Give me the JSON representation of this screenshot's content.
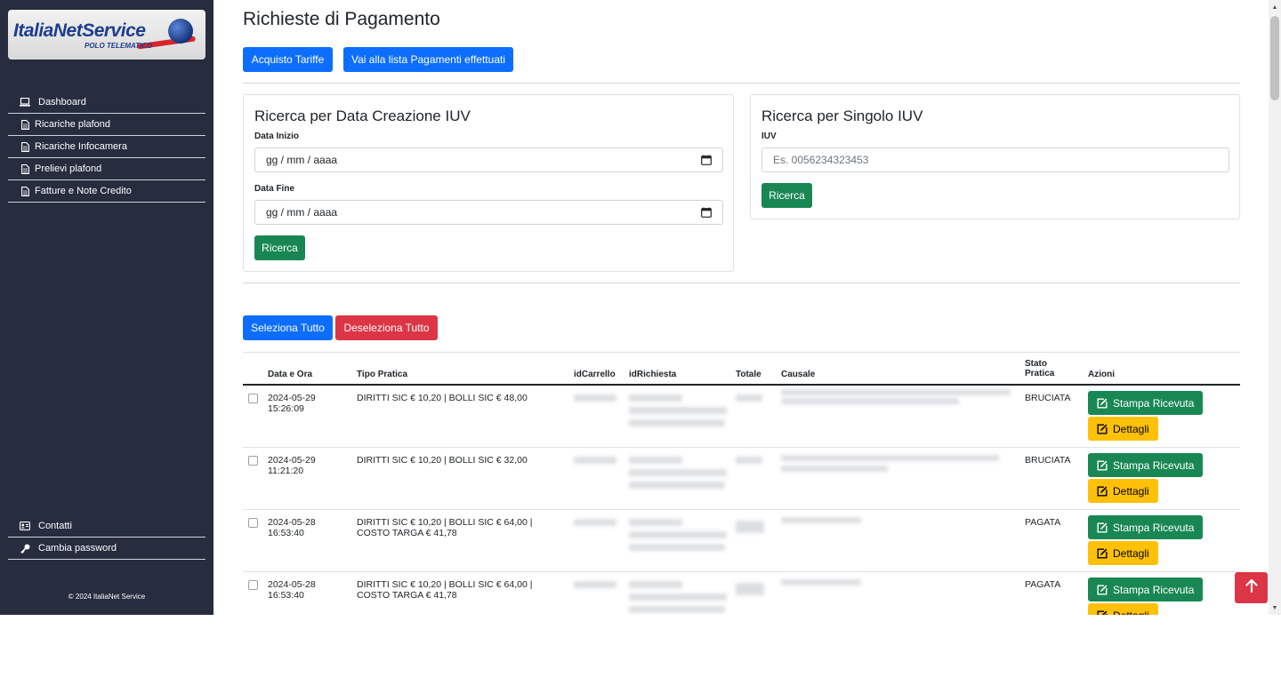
{
  "brand": {
    "name_part1": "Italia",
    "name_part2": "NetService",
    "tagline": "POLO TELEMATICO"
  },
  "sidebar": {
    "items": [
      {
        "label": "Dashboard",
        "icon": "laptop-icon"
      },
      {
        "label": "Ricariche plafond",
        "icon": "document-icon"
      },
      {
        "label": "Ricariche Infocamera",
        "icon": "document-icon"
      },
      {
        "label": "Prelievi plafond",
        "icon": "document-icon"
      },
      {
        "label": "Fatture e Note Credito",
        "icon": "document-icon"
      }
    ],
    "bottom_items": [
      {
        "label": "Contatti",
        "icon": "contact-card-icon"
      },
      {
        "label": "Cambia password",
        "icon": "key-icon"
      }
    ],
    "copyright": "© 2024 ItaliaNet Service"
  },
  "page": {
    "title": "Richieste di Pagamento",
    "buttons": {
      "acquisto": "Acquisto Tariffe",
      "lista": "Vai alla lista Pagamenti effettuati"
    }
  },
  "search_date": {
    "title": "Ricerca per Data Creazione IUV",
    "start_label": "Data Inizio",
    "start_value": "gg / mm / aaaa",
    "end_label": "Data Fine",
    "end_value": "gg / mm / aaaa",
    "button": "Ricerca"
  },
  "search_iuv": {
    "title": "Ricerca per Singolo IUV",
    "label": "IUV",
    "placeholder": "Es. 0056234323453",
    "button": "Ricerca"
  },
  "selection": {
    "select_all": "Seleziona Tutto",
    "deselect_all": "Deseleziona Tutto"
  },
  "table": {
    "headers": {
      "date": "Data e Ora",
      "type": "Tipo Pratica",
      "cart": "idCarrello",
      "request": "idRichiesta",
      "total": "Totale",
      "reason": "Causale",
      "status_1": "Stato",
      "status_2": "Pratica",
      "actions": "Azioni"
    },
    "rows": [
      {
        "date": "2024-05-29",
        "time": "15:26:09",
        "type": "DIRITTI SIC € 10,20 | BOLLI SIC € 48,00",
        "status": "BRUCIATA"
      },
      {
        "date": "2024-05-29",
        "time": "11:21:20",
        "type": "DIRITTI SIC € 10,20 | BOLLI SIC € 32,00",
        "status": "BRUCIATA"
      },
      {
        "date": "2024-05-28",
        "time": "16:53:40",
        "type": "DIRITTI SIC € 10,20 | BOLLI SIC € 64,00 | COSTO TARGA € 41,78",
        "status": "PAGATA"
      },
      {
        "date": "2024-05-28",
        "time": "16:53:40",
        "type": "DIRITTI SIC € 10,20 | BOLLI SIC € 64,00 | COSTO TARGA € 41,78",
        "status": "PAGATA"
      }
    ],
    "action_print": "Stampa Ricevuta",
    "action_details": "Dettagli"
  },
  "colors": {
    "sidebar_bg": "#272c3f",
    "primary": "#0d6efd",
    "danger": "#dc3545",
    "success": "#198754",
    "warning": "#ffc107"
  }
}
